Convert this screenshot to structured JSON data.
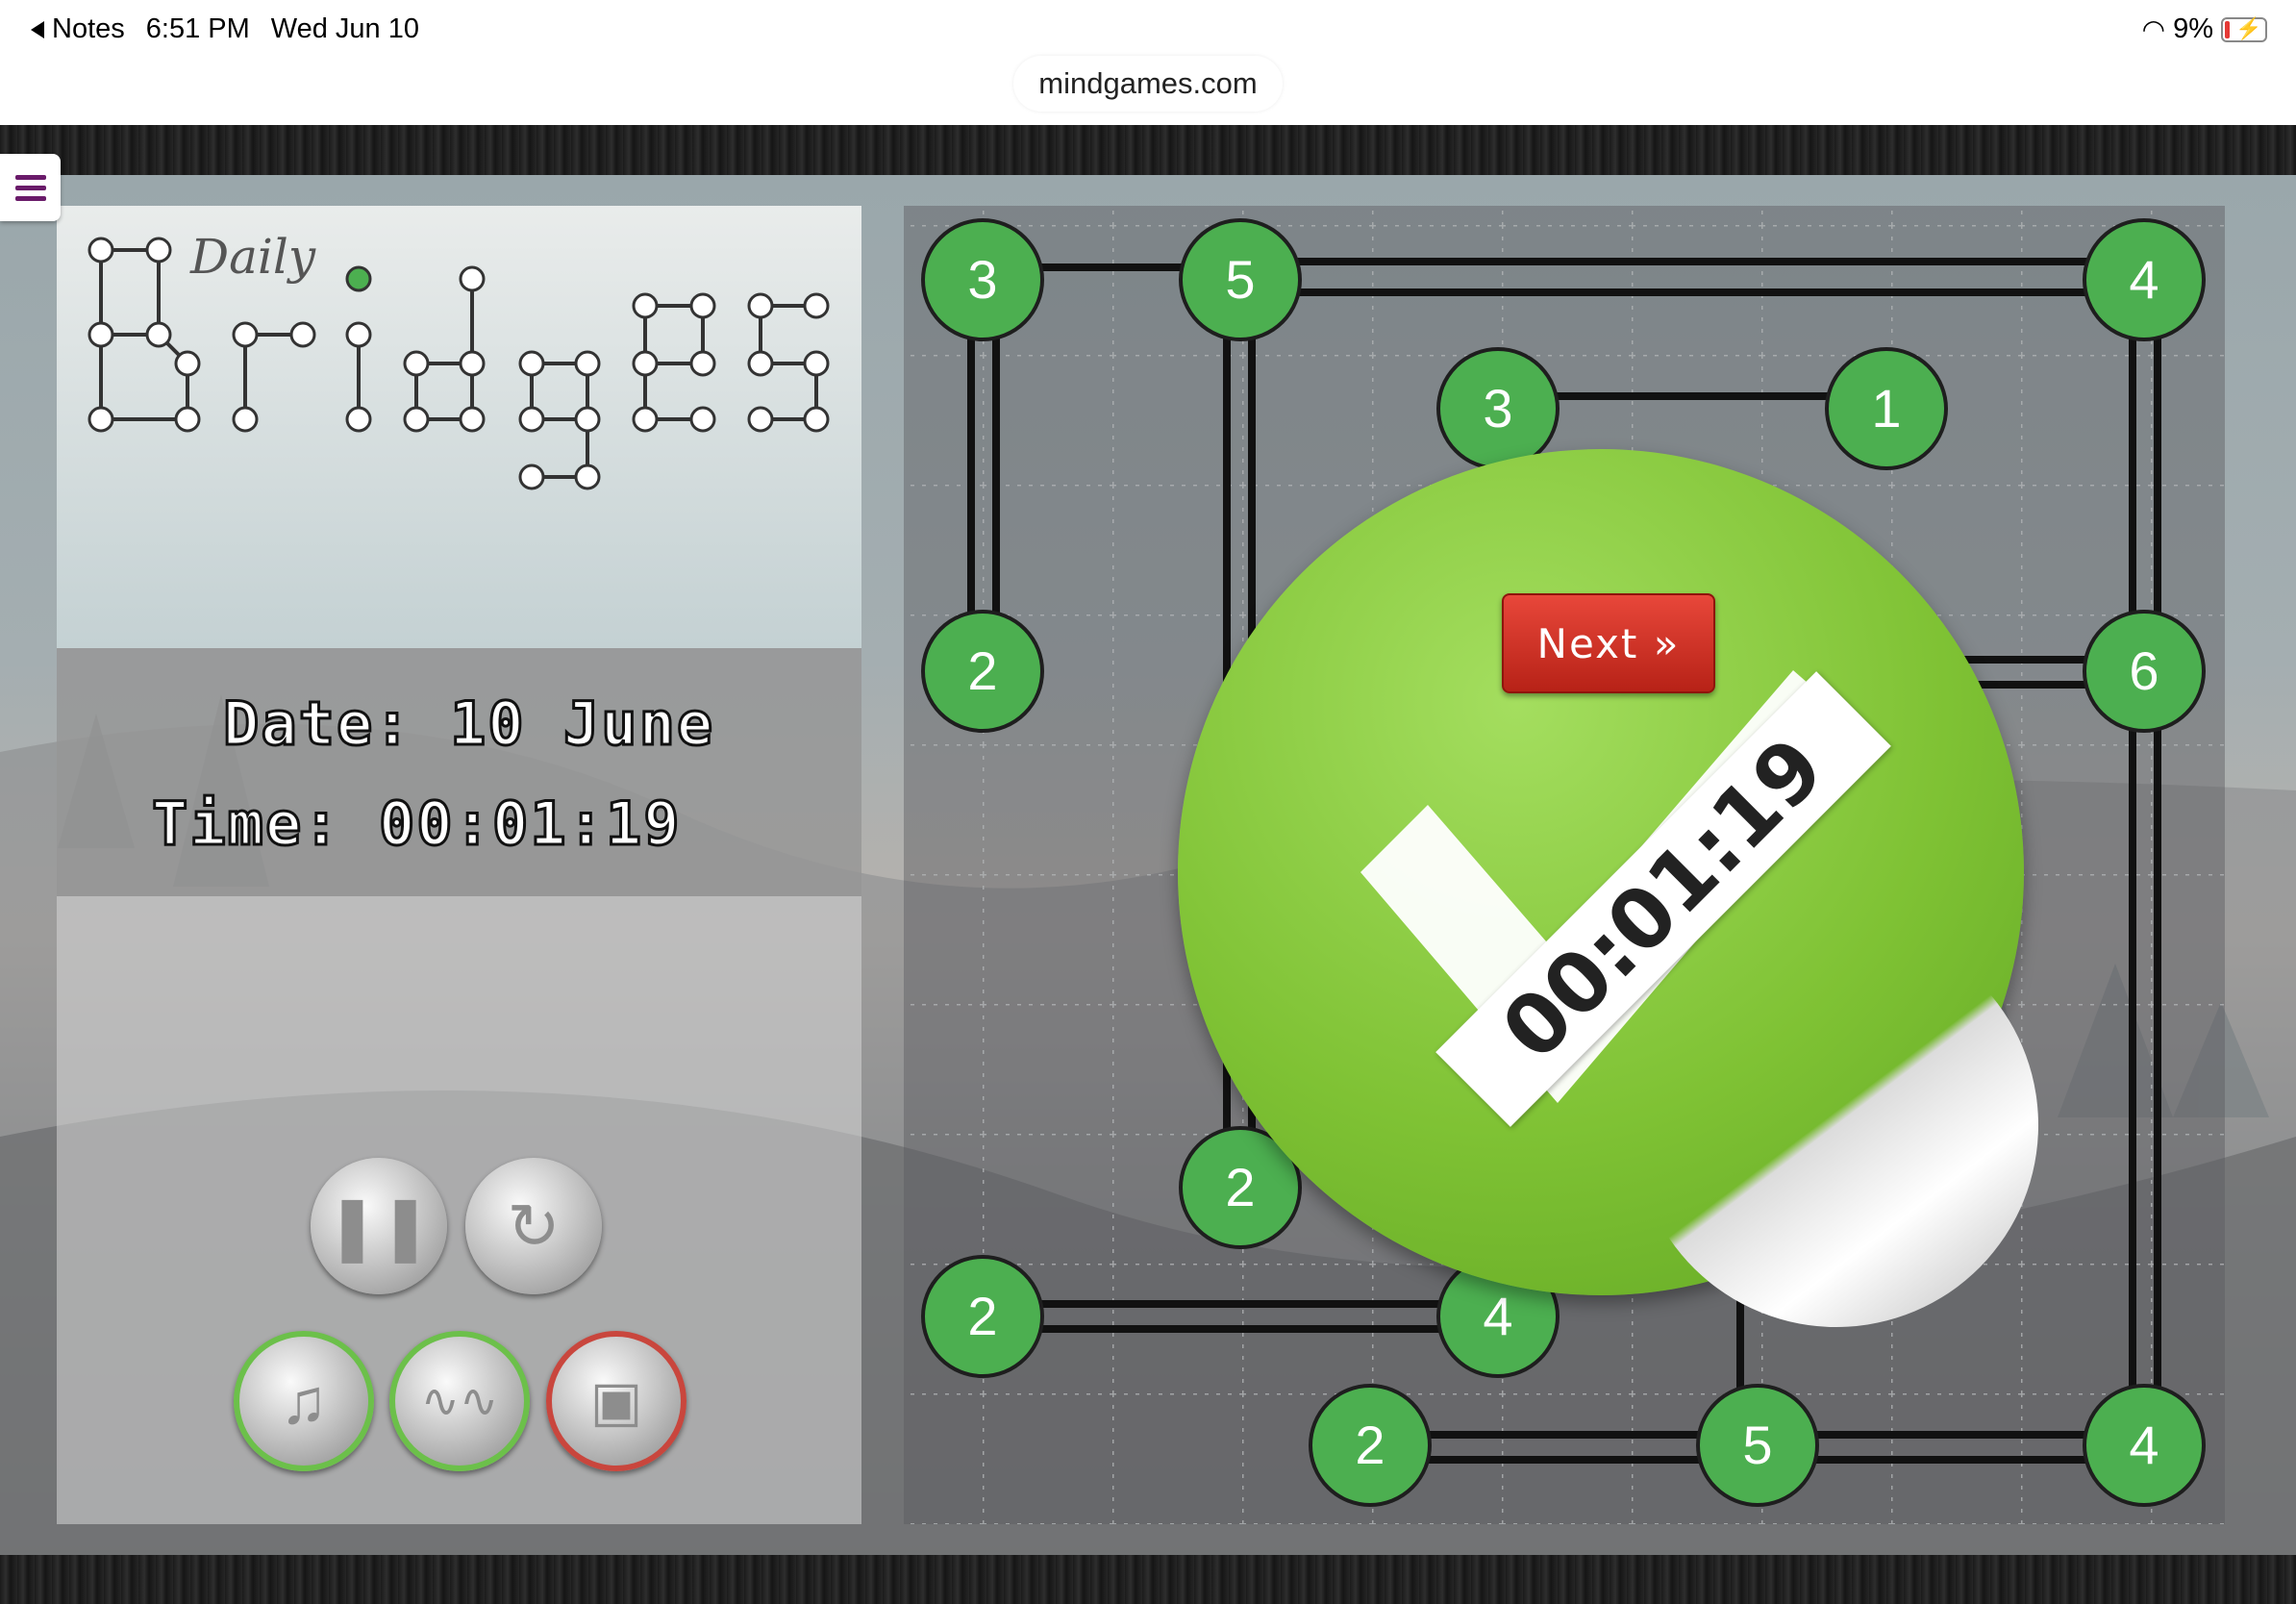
{
  "status_bar": {
    "back_label": "Notes",
    "time": "6:51 PM",
    "date": "Wed Jun 10",
    "battery": "9%"
  },
  "browser": {
    "url": "mindgames.com"
  },
  "logo": {
    "daily": "Daily"
  },
  "stats": {
    "date_label": "Date: 10 June",
    "time_label": "Time: 00:01:19"
  },
  "controls": [
    {
      "name": "pause-button",
      "icon": "pause-icon"
    },
    {
      "name": "restart-button",
      "icon": "restart-icon"
    },
    {
      "name": "music-button",
      "icon": "music-note-icon"
    },
    {
      "name": "sound-button",
      "icon": "sound-wave-icon"
    },
    {
      "name": "display-button",
      "icon": "monitor-icon"
    }
  ],
  "puzzle": {
    "islands": [
      {
        "id": "a",
        "value": "3"
      },
      {
        "id": "b",
        "value": "5"
      },
      {
        "id": "c",
        "value": "4"
      },
      {
        "id": "d",
        "value": "3"
      },
      {
        "id": "e",
        "value": "1"
      },
      {
        "id": "f",
        "value": "2"
      },
      {
        "id": "g",
        "value": "6"
      },
      {
        "id": "h",
        "value": "2"
      },
      {
        "id": "i",
        "value": "2"
      },
      {
        "id": "j",
        "value": "4"
      },
      {
        "id": "k",
        "value": "2"
      },
      {
        "id": "l",
        "value": "5"
      },
      {
        "id": "m",
        "value": "4"
      }
    ]
  },
  "completion": {
    "next_label": "Next »",
    "elapsed": "00:01:19"
  },
  "colors": {
    "island_fill": "#4caf50",
    "badge_green": "#7fc234",
    "next_red": "#d0342a",
    "menu_purple": "#6a1b6a"
  }
}
